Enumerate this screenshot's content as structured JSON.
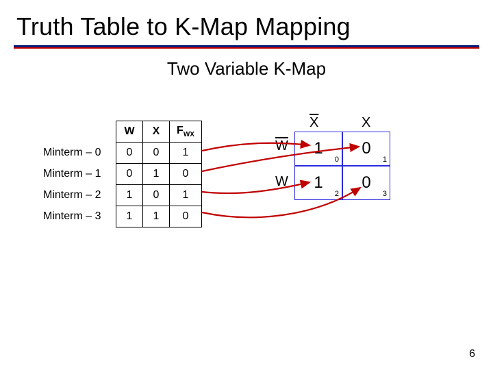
{
  "title": "Truth Table to K-Map Mapping",
  "subtitle": "Two Variable K-Map",
  "truth_table": {
    "headers": {
      "w": "W",
      "x": "X",
      "f": "F",
      "fsub": "WX"
    },
    "rows": [
      {
        "label": "Minterm – 0",
        "w": "0",
        "x": "0",
        "f": "1"
      },
      {
        "label": "Minterm – 1",
        "w": "0",
        "x": "1",
        "f": "0"
      },
      {
        "label": "Minterm – 2",
        "w": "1",
        "x": "0",
        "f": "1"
      },
      {
        "label": "Minterm – 3",
        "w": "1",
        "x": "1",
        "f": "0"
      }
    ]
  },
  "kmap": {
    "col_labels": {
      "c0": "X",
      "c1": "X"
    },
    "row_labels": {
      "r0": "W",
      "r1": "W"
    },
    "cells": {
      "c00": {
        "v": "1",
        "idx": "0"
      },
      "c01": {
        "v": "0",
        "idx": "1"
      },
      "c10": {
        "v": "1",
        "idx": "2"
      },
      "c11": {
        "v": "0",
        "idx": "3"
      }
    }
  },
  "page_number": "6"
}
